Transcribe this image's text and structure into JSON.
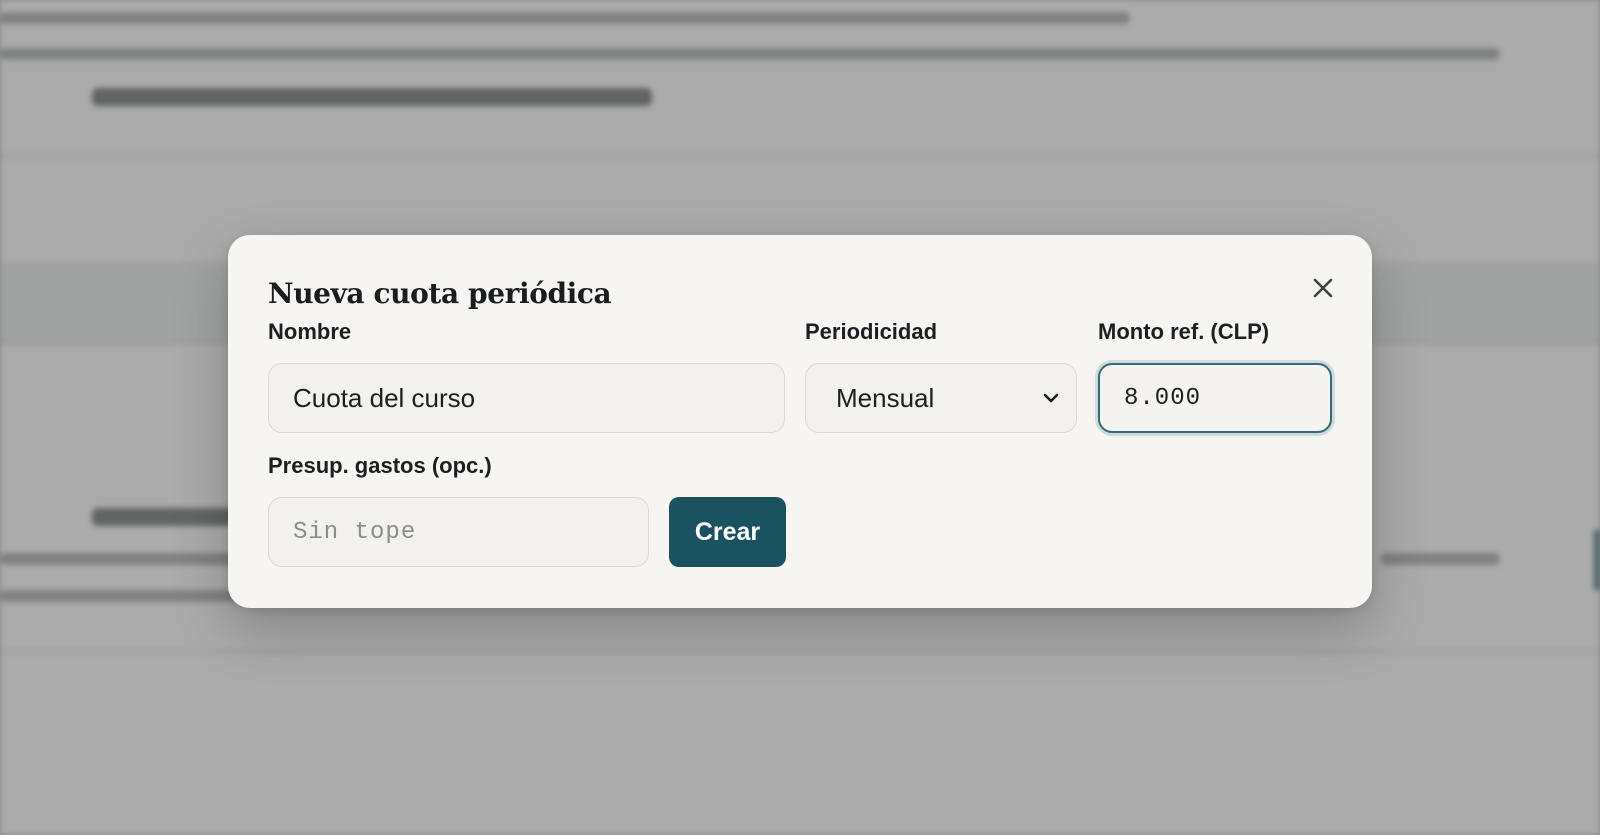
{
  "modal": {
    "title": "Nueva cuota periódica",
    "close_icon": "close-icon"
  },
  "form": {
    "name": {
      "label": "Nombre",
      "value": "Cuota del curso"
    },
    "periodicity": {
      "label": "Periodicidad",
      "selected": "Mensual",
      "icon": "chevron-down-icon"
    },
    "amount": {
      "label": "Monto ref. (CLP)",
      "value": "8.000"
    },
    "budget": {
      "label": "Presup. gastos (opc.)",
      "value": "",
      "placeholder": "Sin tope"
    },
    "submit_label": "Crear"
  },
  "colors": {
    "primary": "#1b525f",
    "focus_border": "#2f6b78",
    "modal_bg": "#f6f5f1"
  }
}
